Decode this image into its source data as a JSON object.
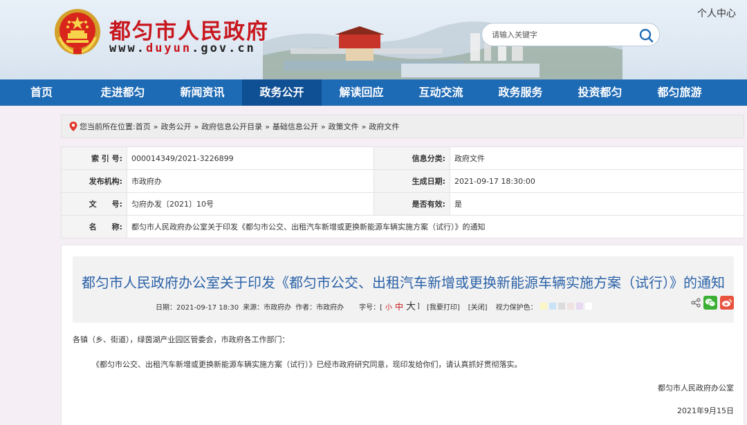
{
  "header": {
    "site_title": "都匀市人民政府",
    "url_prefix": "www.",
    "url_highlight": "duyun",
    "url_suffix": ".gov.cn",
    "user_center": "个人中心",
    "search_placeholder": "请输入关键字",
    "brand_color": "#c8161d"
  },
  "nav": {
    "items": [
      "首页",
      "走进都匀",
      "新闻资讯",
      "政务公开",
      "解读回应",
      "互动交流",
      "政务服务",
      "投资都匀",
      "都匀旅游"
    ],
    "active": "政务公开",
    "bg_color": "#1d6ab5"
  },
  "breadcrumb": {
    "prefix": "您当前所在位置:",
    "items": [
      "首页",
      "政务公开",
      "政府信息公开目录",
      "基础信息公开",
      "政策文件",
      "政府文件"
    ],
    "separator": "»"
  },
  "info": {
    "index_label": "索 引 号:",
    "index_value": "000014349/2021-3226899",
    "category_label": "信息分类:",
    "category_value": "政府文件",
    "issuer_label": "发布机构:",
    "issuer_value": "市政府办",
    "date_label": "生成日期:",
    "date_value": "2021-09-17 18:30:00",
    "docno_label": "文　　号:",
    "docno_value": "匀府办发〔2021〕10号",
    "valid_label": "是否有效:",
    "valid_value": "是",
    "name_label": "名　　称:",
    "name_value": "都匀市人民政府办公室关于印发《都匀市公交、出租汽车新增或更换新能源车辆实施方案（试行）》的通知"
  },
  "article": {
    "title": "都匀市人民政府办公室关于印发《都匀市公交、出租汽车新增或更换新能源车辆实施方案（试行）》的通知",
    "meta_date": "日期：2021-09-17 18:30",
    "meta_source": "来源：市政府办",
    "meta_author": "作者：市政府办",
    "font_label": "字号：[",
    "font_small": "小",
    "font_mid": "中",
    "font_big": "大",
    "font_close": "]",
    "print": "[我要打印]",
    "close": "[关闭]",
    "eye_label": "视力保护色：",
    "eye_colors": [
      "#fbf6c5",
      "#c9e2f5",
      "#dcdcdc",
      "#f1e2e2",
      "#e6d9f1",
      "#ffffff"
    ],
    "greeting": "各镇（乡、街道），绿茵湖产业园区管委会，市政府各工作部门：",
    "main_para": "《都匀市公交、出租汽车新增或更换新能源车辆实施方案（试行）》已经市政府研究同意，现印发给你们，请认真抓好贯彻落实。",
    "signature": "都匀市人民政府办公室",
    "sign_date": "2021年9月15日"
  }
}
